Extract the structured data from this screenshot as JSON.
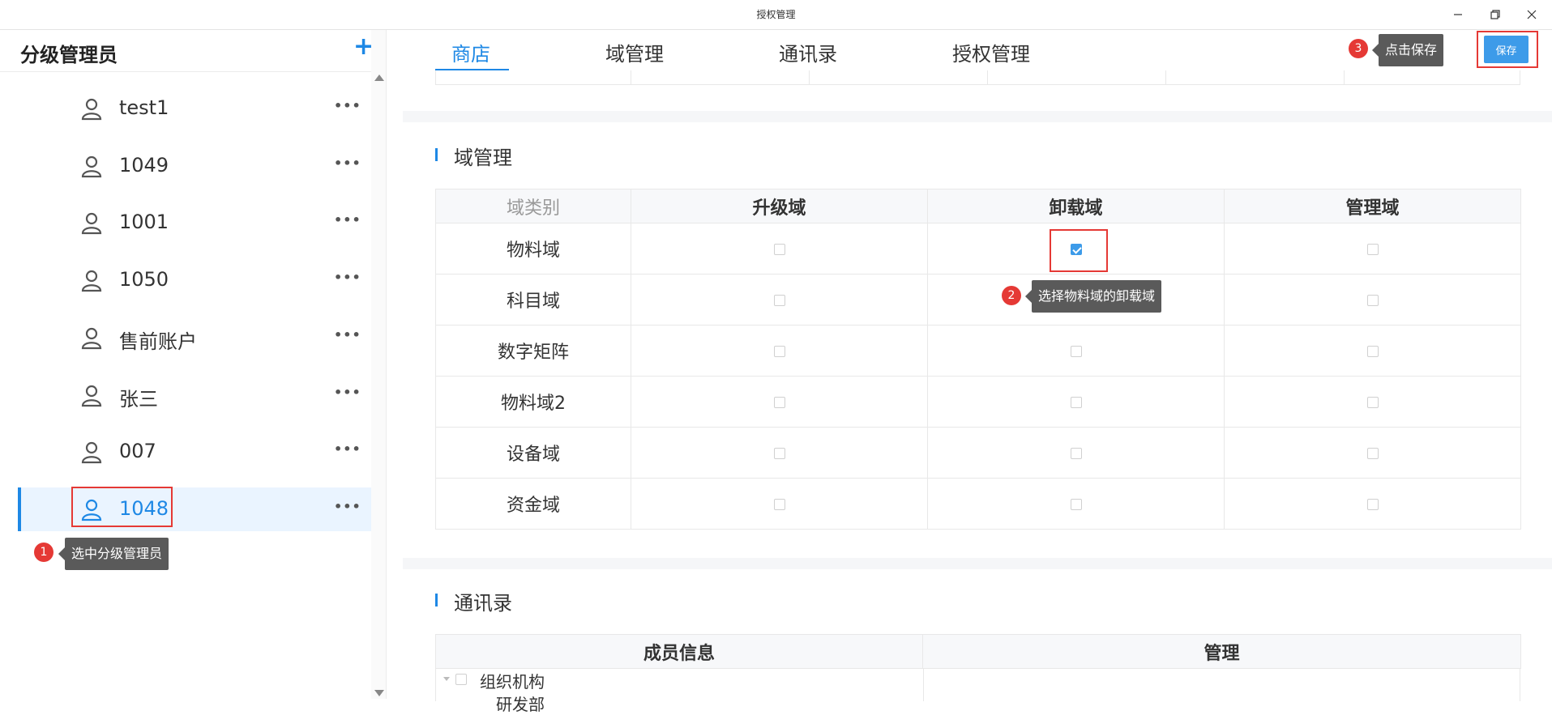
{
  "window": {
    "title": "授权管理"
  },
  "sidebar": {
    "title": "分级管理员",
    "add_label": "+",
    "more_label": "•••",
    "users": [
      {
        "name": "test1"
      },
      {
        "name": "1049"
      },
      {
        "name": "1001"
      },
      {
        "name": "1050"
      },
      {
        "name": "售前账户"
      },
      {
        "name": "张三"
      },
      {
        "name": "007"
      },
      {
        "name": "1048",
        "selected": true
      }
    ]
  },
  "tabs": [
    {
      "label": "商店",
      "active": true
    },
    {
      "label": "域管理"
    },
    {
      "label": "通讯录"
    },
    {
      "label": "授权管理"
    }
  ],
  "toolbar": {
    "save_label": "保存"
  },
  "domain_section": {
    "title": "域管理",
    "columns": [
      "域类别",
      "升级域",
      "卸载域",
      "管理域"
    ],
    "rows": [
      {
        "name": "物料域",
        "checks": [
          false,
          true,
          false
        ]
      },
      {
        "name": "科目域",
        "checks": [
          false,
          false,
          false
        ]
      },
      {
        "name": "数字矩阵",
        "checks": [
          false,
          false,
          false
        ]
      },
      {
        "name": "物料域2",
        "checks": [
          false,
          false,
          false
        ]
      },
      {
        "name": "设备域",
        "checks": [
          false,
          false,
          false
        ]
      },
      {
        "name": "资金域",
        "checks": [
          false,
          false,
          false
        ]
      }
    ]
  },
  "contacts_section": {
    "title": "通讯录",
    "columns": [
      "成员信息",
      "管理"
    ],
    "tree": [
      {
        "label": "组织机构"
      },
      {
        "label": "研发部"
      }
    ]
  },
  "annotations": [
    {
      "num": "1",
      "text": "选中分级管理员"
    },
    {
      "num": "2",
      "text": "选择物料域的卸载域"
    },
    {
      "num": "3",
      "text": "点击保存"
    }
  ],
  "colors": {
    "accent": "#1e88e5",
    "annotation_red": "#e53935",
    "tooltip_bg": "#5a5a5a"
  }
}
